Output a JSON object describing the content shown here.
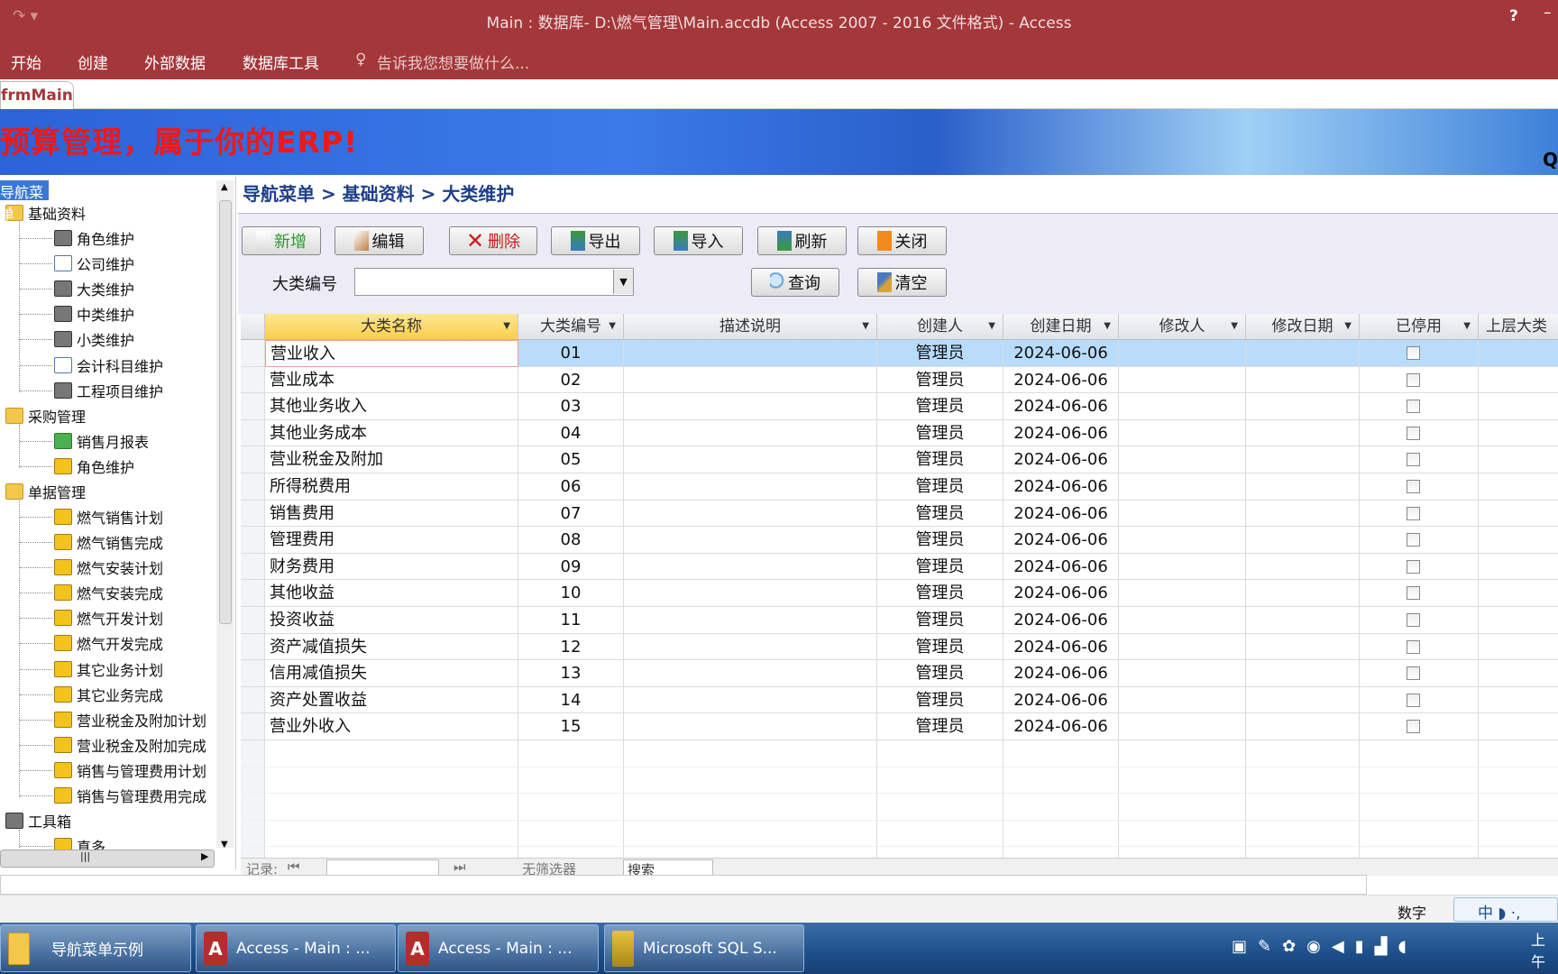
{
  "window": {
    "title": "Main : 数据库- D:\\燃气管理\\Main.accdb (Access 2007 - 2016 文件格式) - Access",
    "help": "?"
  },
  "ribbon": {
    "tabs": [
      "开始",
      "创建",
      "外部数据",
      "数据库工具"
    ],
    "tell_me": "告诉我您想要做什么..."
  },
  "doc_tab": "frmMain",
  "banner": {
    "slogan": "预算管理，属于你的ERP!",
    "right_text": "Q"
  },
  "sidebar": {
    "header": "导航菜单",
    "groups": [
      {
        "label": "基础资料",
        "icon": "folder",
        "items": [
          {
            "label": "角色维护",
            "icon": "tools"
          },
          {
            "label": "公司维护",
            "icon": "doc"
          },
          {
            "label": "大类维护",
            "icon": "tools"
          },
          {
            "label": "中类维护",
            "icon": "tools"
          },
          {
            "label": "小类维护",
            "icon": "tools"
          },
          {
            "label": "会计科目维护",
            "icon": "doc"
          },
          {
            "label": "工程项目维护",
            "icon": "tools"
          }
        ]
      },
      {
        "label": "采购管理",
        "icon": "folder",
        "items": [
          {
            "label": "销售月报表",
            "icon": "basket"
          },
          {
            "label": "角色维护",
            "icon": "lock"
          }
        ]
      },
      {
        "label": "单据管理",
        "icon": "folder",
        "items": [
          {
            "label": "燃气销售计划",
            "icon": "lock"
          },
          {
            "label": "燃气销售完成",
            "icon": "lock"
          },
          {
            "label": "燃气安装计划",
            "icon": "lock"
          },
          {
            "label": "燃气安装完成",
            "icon": "lock"
          },
          {
            "label": "燃气开发计划",
            "icon": "lock"
          },
          {
            "label": "燃气开发完成",
            "icon": "lock"
          },
          {
            "label": "其它业务计划",
            "icon": "lock"
          },
          {
            "label": "其它业务完成",
            "icon": "lock"
          },
          {
            "label": "营业税金及附加计划",
            "icon": "lock"
          },
          {
            "label": "营业税金及附加完成",
            "icon": "lock"
          },
          {
            "label": "销售与管理费用计划",
            "icon": "lock"
          },
          {
            "label": "销售与管理费用完成",
            "icon": "lock"
          }
        ]
      },
      {
        "label": "工具箱",
        "icon": "tool",
        "items": [
          {
            "label": "真多",
            "icon": "lock"
          }
        ]
      }
    ]
  },
  "breadcrumb": "导航菜单 > 基础资料 > 大类维护",
  "toolbar": {
    "buttons": [
      {
        "id": "add",
        "label": "新增",
        "color": "#2a9a2a"
      },
      {
        "id": "edit",
        "label": "编辑",
        "color": "#111"
      },
      {
        "id": "delete",
        "label": "删除",
        "color": "#d01818"
      },
      {
        "id": "export",
        "label": "导出",
        "color": "#111"
      },
      {
        "id": "import",
        "label": "导入",
        "color": "#111"
      },
      {
        "id": "refresh",
        "label": "刷新",
        "color": "#111"
      },
      {
        "id": "close",
        "label": "关闭",
        "color": "#111"
      }
    ],
    "filter_label": "大类编号",
    "filter_value": "",
    "query": "查询",
    "clear": "清空"
  },
  "grid": {
    "columns": [
      "大类名称",
      "大类编号",
      "描述说明",
      "创建人",
      "创建日期",
      "修改人",
      "修改日期",
      "已停用",
      "上层大类"
    ],
    "rows": [
      [
        "营业收入",
        "01",
        "",
        "管理员",
        "2024-06-06",
        "",
        "",
        false
      ],
      [
        "营业成本",
        "02",
        "",
        "管理员",
        "2024-06-06",
        "",
        "",
        false
      ],
      [
        "其他业务收入",
        "03",
        "",
        "管理员",
        "2024-06-06",
        "",
        "",
        false
      ],
      [
        "其他业务成本",
        "04",
        "",
        "管理员",
        "2024-06-06",
        "",
        "",
        false
      ],
      [
        "营业税金及附加",
        "05",
        "",
        "管理员",
        "2024-06-06",
        "",
        "",
        false
      ],
      [
        "所得税费用",
        "06",
        "",
        "管理员",
        "2024-06-06",
        "",
        "",
        false
      ],
      [
        "销售费用",
        "07",
        "",
        "管理员",
        "2024-06-06",
        "",
        "",
        false
      ],
      [
        "管理费用",
        "08",
        "",
        "管理员",
        "2024-06-06",
        "",
        "",
        false
      ],
      [
        "财务费用",
        "09",
        "",
        "管理员",
        "2024-06-06",
        "",
        "",
        false
      ],
      [
        "其他收益",
        "10",
        "",
        "管理员",
        "2024-06-06",
        "",
        "",
        false
      ],
      [
        "投资收益",
        "11",
        "",
        "管理员",
        "2024-06-06",
        "",
        "",
        false
      ],
      [
        "资产减值损失",
        "12",
        "",
        "管理员",
        "2024-06-06",
        "",
        "",
        false
      ],
      [
        "信用减值损失",
        "13",
        "",
        "管理员",
        "2024-06-06",
        "",
        "",
        false
      ],
      [
        "资产处置收益",
        "14",
        "",
        "管理员",
        "2024-06-06",
        "",
        "",
        false
      ],
      [
        "营业外收入",
        "15",
        "",
        "管理员",
        "2024-06-06",
        "",
        "",
        false
      ]
    ]
  },
  "navbar": {
    "record_label": "记录:",
    "filter": "无筛选器",
    "search": "搜索"
  },
  "status": {
    "mode": "数字",
    "ime": "中"
  },
  "taskbar": {
    "items": [
      "导航菜单示例",
      "Access - Main : ...",
      "Access - Main : ...",
      "Microsoft SQL S..."
    ],
    "clock": "上午"
  }
}
